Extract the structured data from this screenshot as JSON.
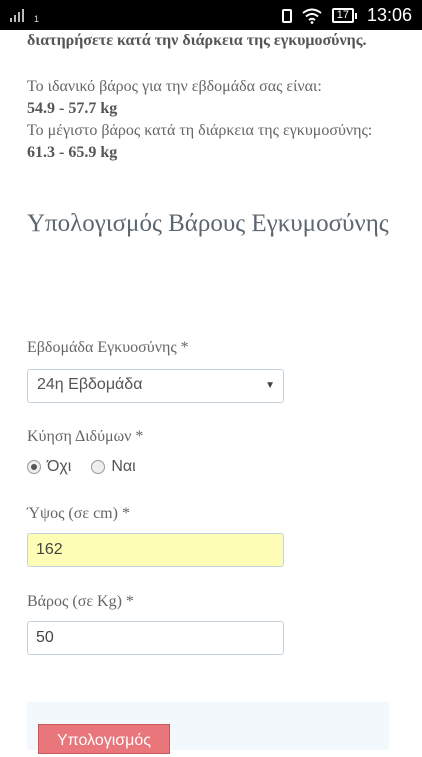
{
  "status_bar": {
    "sim": "1",
    "battery": "17",
    "time": "13:06"
  },
  "intro": {
    "text": "διατηρήσετε κατά την διάρκεια της εγκυμοσύνης."
  },
  "info": {
    "ideal_label": "Το ιδανικό βάρος για την εβδομάδα σας είναι:",
    "ideal_value": "54.9 - 57.7 kg",
    "max_label": "Το μέγιστο βάρος κατά τη διάρκεια της εγκυμοσύνης:",
    "max_value": "61.3 - 65.9 kg"
  },
  "form": {
    "title": "Υπολογισμός Βάρους Εγκυμοσύνης",
    "week": {
      "label": "Εβδομάδα Εγκυοσύνης *",
      "selected": "24η Εβδομάδα"
    },
    "twins": {
      "label": "Κύηση Διδύμων *",
      "options": [
        "Όχι",
        "Ναι"
      ],
      "selected": "Όχι"
    },
    "height": {
      "label": "Ύψος (σε cm) *",
      "value": "162"
    },
    "weight": {
      "label": "Βάρος (σε Kg) *",
      "value": "50"
    },
    "submit": "Υπολογισμός"
  },
  "colors": {
    "button": "#e8767b",
    "height_field_bg": "#fdfdb5",
    "title": "#5b6670"
  }
}
